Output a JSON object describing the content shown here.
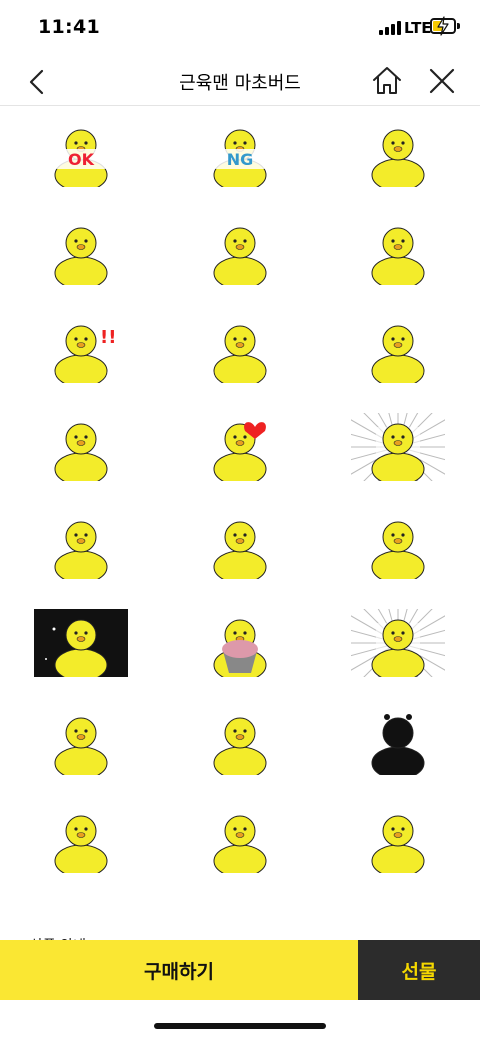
{
  "status": {
    "time": "11:41",
    "network": "LTE"
  },
  "nav": {
    "title": "근육맨 마초버드"
  },
  "stickers": [
    {
      "icon": "ok-sticker-icon",
      "text": "OK"
    },
    {
      "icon": "ng-sticker-icon",
      "text": "NG"
    },
    {
      "icon": "bowing-sticker-icon"
    },
    {
      "icon": "flexing-sticker-icon"
    },
    {
      "icon": "singing-sticker-icon"
    },
    {
      "icon": "sleeping-sticker-icon"
    },
    {
      "icon": "surprised-sticker-icon"
    },
    {
      "icon": "thinking-sticker-icon"
    },
    {
      "icon": "bending-sticker-icon"
    },
    {
      "icon": "pointing-sticker-icon"
    },
    {
      "icon": "heart-kiss-sticker-icon"
    },
    {
      "icon": "shocked-sticker-icon"
    },
    {
      "icon": "back-view-sticker-icon"
    },
    {
      "icon": "punch-wall-sticker-icon"
    },
    {
      "icon": "dancing-sticker-icon"
    },
    {
      "icon": "night-sky-sticker-icon"
    },
    {
      "icon": "cupcake-sticker-icon"
    },
    {
      "icon": "pose-sticker-icon"
    },
    {
      "icon": "idea-sticker-icon"
    },
    {
      "icon": "bunny-ears-sticker-icon"
    },
    {
      "icon": "shadow-sticker-icon"
    },
    {
      "icon": "pillow-sticker-icon"
    },
    {
      "icon": "shower-sticker-icon"
    },
    {
      "icon": "praying-sticker-icon"
    }
  ],
  "info": {
    "title": "상품 안내"
  },
  "actions": {
    "buy": "구매하기",
    "gift": "선물"
  },
  "colors": {
    "accent": "#fae733",
    "gift_bg": "#2c2c2c",
    "gift_text": "#f5d800",
    "bird": "#f3ec2a"
  }
}
